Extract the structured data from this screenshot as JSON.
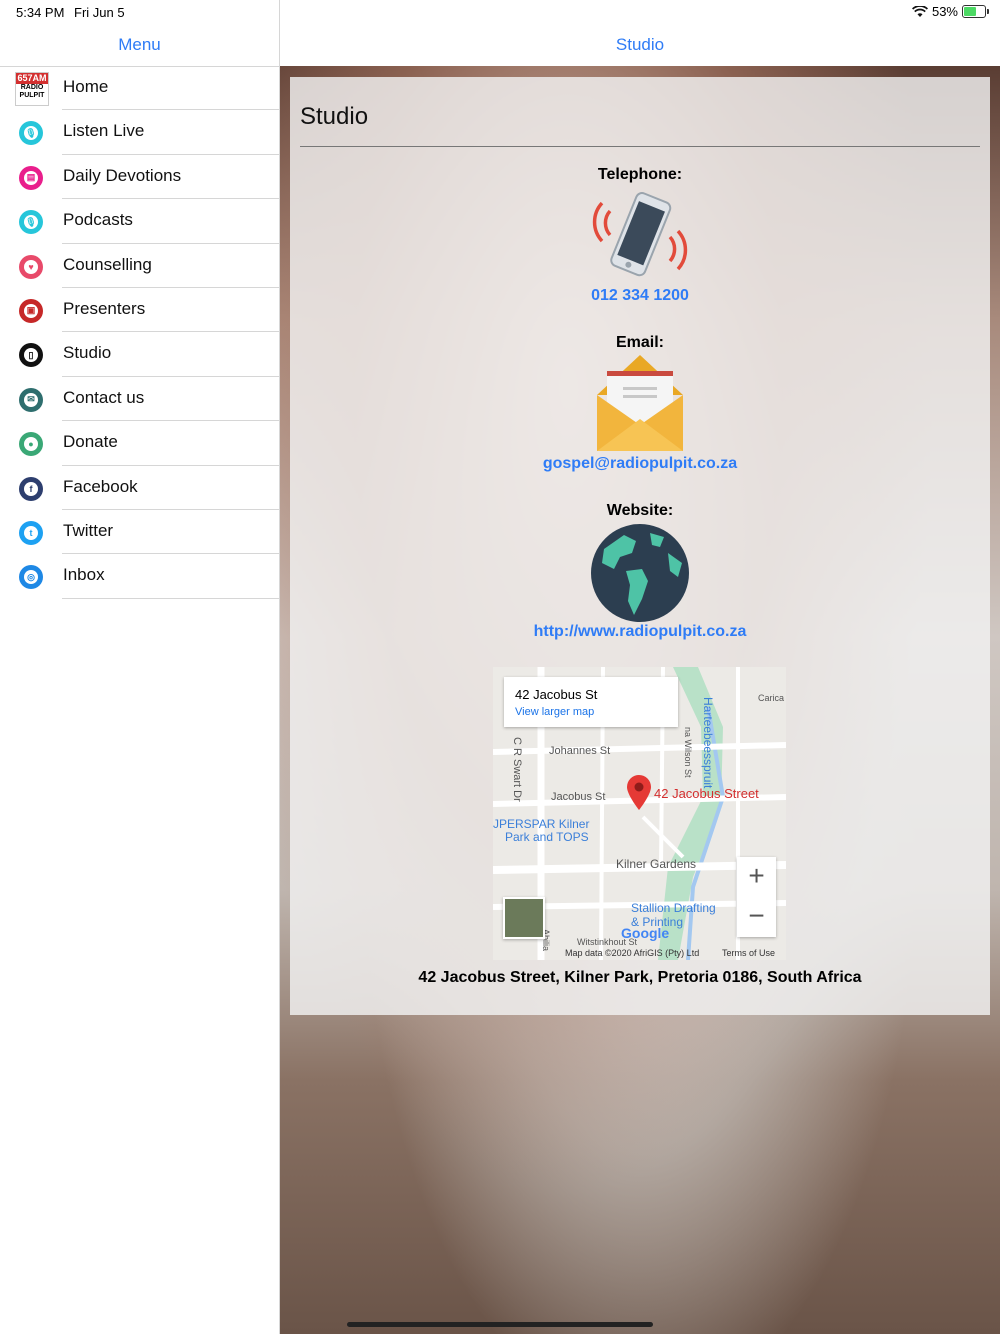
{
  "status": {
    "time": "5:34 PM",
    "date": "Fri Jun 5",
    "battery": "53%"
  },
  "sidebar": {
    "title": "Menu",
    "items": [
      {
        "label": "Home",
        "icon": "radio-pulpit-logo-icon",
        "color": "#d32f2f"
      },
      {
        "label": "Listen Live",
        "icon": "microphone-icon",
        "color": "#26c6da"
      },
      {
        "label": "Daily Devotions",
        "icon": "book-icon",
        "color": "#e91e8c"
      },
      {
        "label": "Podcasts",
        "icon": "microphone-icon",
        "color": "#26c6da"
      },
      {
        "label": "Counselling",
        "icon": "heart-icon",
        "color": "#e84a6a"
      },
      {
        "label": "Presenters",
        "icon": "presenters-icon",
        "color": "#c62828"
      },
      {
        "label": "Studio",
        "icon": "phone-icon",
        "color": "#111111"
      },
      {
        "label": "Contact us",
        "icon": "envelope-icon",
        "color": "#2e6e6e"
      },
      {
        "label": "Donate",
        "icon": "donate-icon",
        "color": "#3aa876"
      },
      {
        "label": "Facebook",
        "icon": "facebook-icon",
        "color": "#2d3e6e"
      },
      {
        "label": "Twitter",
        "icon": "twitter-icon",
        "color": "#1da1f2"
      },
      {
        "label": "Inbox",
        "icon": "inbox-icon",
        "color": "#1e88e5"
      }
    ]
  },
  "main": {
    "nav_title": "Studio",
    "page_title": "Studio",
    "telephone": {
      "label": "Telephone:",
      "value": "012 334 1200"
    },
    "email": {
      "label": "Email:",
      "value": "gospel@radiopulpit.co.za"
    },
    "website": {
      "label": "Website:",
      "value": "http://www.radiopulpit.co.za"
    },
    "map": {
      "info_title": "42 Jacobus St",
      "info_link": "View larger map",
      "pin_label": "42 Jacobus Street",
      "labels": [
        "Johannes St",
        "Jacobus St",
        "C R Swart Dr",
        "Harteebeesspruit",
        "JPERSPAR Kilner",
        "Park and TOPS",
        "Kilner Gardens",
        "Stallion Drafting",
        "& Printing",
        "na Wilson St",
        "Carica",
        "Abilia",
        "Witstinkhout St"
      ],
      "attribution": "Map data ©2020 AfriGIS (Pty) Ltd",
      "terms": "Terms of Use",
      "google": "Google",
      "zoom_in": "+",
      "zoom_out": "−"
    },
    "address": "42 Jacobus Street, Kilner Park, Pretoria 0186, South Africa"
  }
}
